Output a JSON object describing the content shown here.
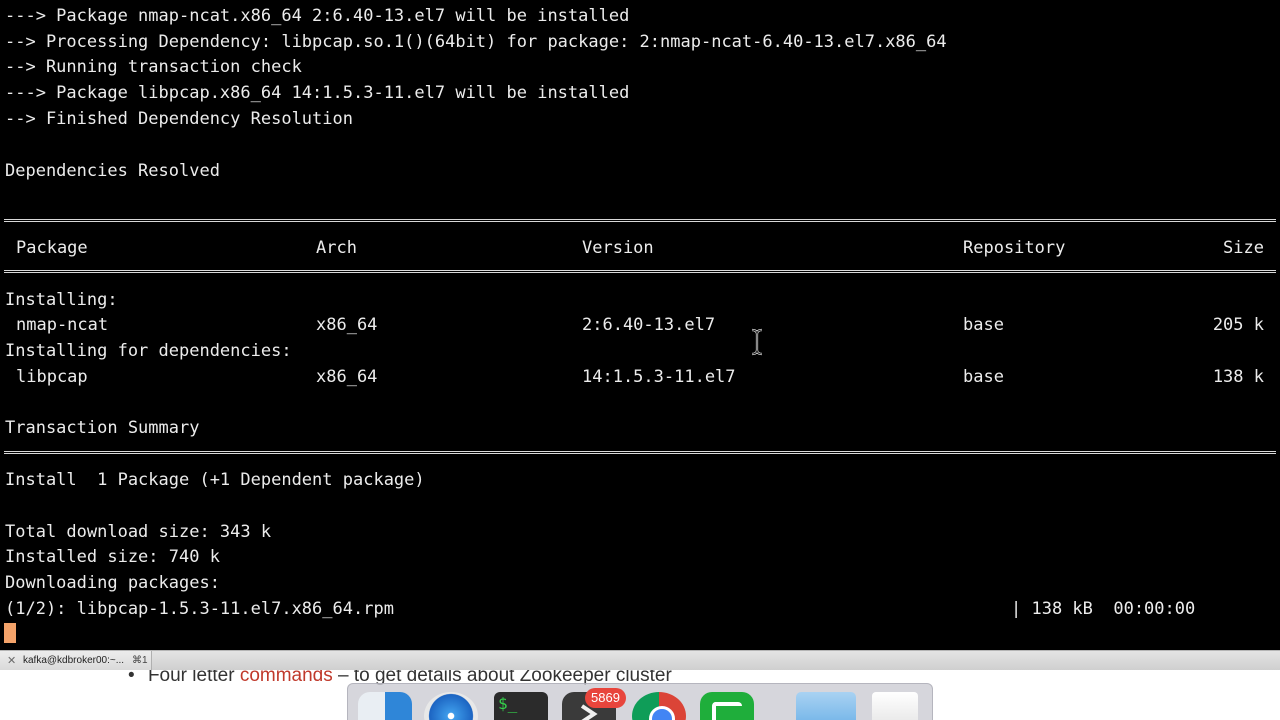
{
  "terminal": {
    "header_lines": [
      "---> Package nmap-ncat.x86_64 2:6.40-13.el7 will be installed",
      "--> Processing Dependency: libpcap.so.1()(64bit) for package: 2:nmap-ncat-6.40-13.el7.x86_64",
      "--> Running transaction check",
      "---> Package libpcap.x86_64 14:1.5.3-11.el7 will be installed",
      "--> Finished Dependency Resolution"
    ],
    "deps_resolved": "Dependencies Resolved",
    "table": {
      "headers": {
        "package": "Package",
        "arch": "Arch",
        "version": "Version",
        "repository": "Repository",
        "size": "Size"
      },
      "installing_label": "Installing:",
      "installing_deps_label": "Installing for dependencies:",
      "rows": [
        {
          "package": "nmap-ncat",
          "arch": "x86_64",
          "version": "2:6.40-13.el7",
          "repository": "base",
          "size": "205 k"
        },
        {
          "package": "libpcap",
          "arch": "x86_64",
          "version": "14:1.5.3-11.el7",
          "repository": "base",
          "size": "138 k"
        }
      ]
    },
    "summary_title": "Transaction Summary",
    "install_line": "Install  1 Package (+1 Dependent package)",
    "total_download": "Total download size: 343 k",
    "installed_size": "Installed size: 740 k",
    "downloading": "Downloading packages:",
    "download_progress": {
      "file": "(1/2): libpcap-1.5.3-11.el7.x86_64.rpm",
      "status": "| 138 kB  00:00:00"
    }
  },
  "tab": {
    "close": "✕",
    "title": "kafka@kdbroker00:~...",
    "shortcut": "⌘1"
  },
  "background_doc": {
    "bullet": "•",
    "text_before": "Four letter ",
    "keyword": "commands",
    "text_after": " – to get details about Zookeeper cluster"
  },
  "dock": {
    "apps": [
      "finder-icon",
      "safari-icon",
      "terminal-icon",
      "sublime-text-icon",
      "chrome-icon",
      "green-app-icon",
      "folder-icon",
      "trash-icon"
    ],
    "badge": "5869",
    "terminal_glyph": "$_"
  },
  "colors": {
    "terminal_bg": "#000000",
    "terminal_fg": "#ececec",
    "cursor": "#f4a36a",
    "keyword": "#c0392b",
    "badge": "#e8453c"
  }
}
